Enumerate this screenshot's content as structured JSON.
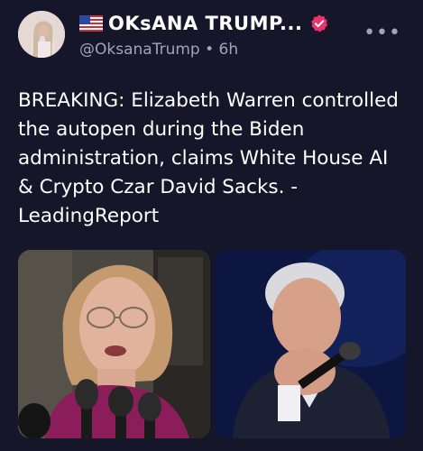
{
  "post": {
    "display_name": "OKsANA TRUMP...",
    "handle": "@OksanaTrump",
    "separator": " • ",
    "time": "6h",
    "more_label": "•••",
    "text": "BREAKING: Elizabeth Warren controlled the autopen during the Biden administration, claims White House AI & Crypto Czar David Sacks. -LeadingReport"
  },
  "icons": {
    "flag": "us-flag-icon",
    "verified": "verified-badge-icon",
    "more": "more-options-icon"
  },
  "colors": {
    "background": "#16162a",
    "text": "#ffffff",
    "muted": "#a2a2bb",
    "verified_badge": "#e8336b"
  }
}
